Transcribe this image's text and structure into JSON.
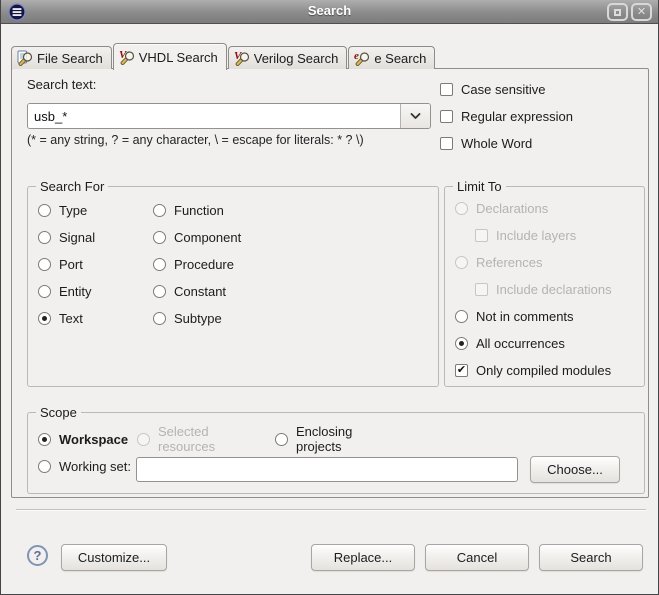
{
  "window": {
    "title": "Search"
  },
  "tabs": [
    {
      "label": "File Search"
    },
    {
      "label": "VHDL Search"
    },
    {
      "label": "Verilog Search"
    },
    {
      "label": "e Search"
    }
  ],
  "search": {
    "label": "Search text:",
    "value": "usb_*",
    "hint": "(* = any string, ? = any character, \\ = escape for literals: * ? \\)"
  },
  "options": [
    {
      "label": "Case sensitive",
      "on": false
    },
    {
      "label": "Regular expression",
      "on": false
    },
    {
      "label": "Whole Word",
      "on": false
    }
  ],
  "search_for": {
    "title": "Search For",
    "col1": [
      {
        "label": "Type",
        "on": false
      },
      {
        "label": "Signal",
        "on": false
      },
      {
        "label": "Port",
        "on": false
      },
      {
        "label": "Entity",
        "on": false
      },
      {
        "label": "Text",
        "on": true
      }
    ],
    "col2": [
      {
        "label": "Function",
        "on": false
      },
      {
        "label": "Component",
        "on": false
      },
      {
        "label": "Procedure",
        "on": false
      },
      {
        "label": "Constant",
        "on": false
      },
      {
        "label": "Subtype",
        "on": false
      }
    ]
  },
  "limit_to": {
    "title": "Limit To",
    "items": [
      {
        "label": "Declarations",
        "type": "radio",
        "on": false,
        "disabled": true,
        "indent": false
      },
      {
        "label": "Include layers",
        "type": "checkbox",
        "on": false,
        "disabled": true,
        "indent": true
      },
      {
        "label": "References",
        "type": "radio",
        "on": false,
        "disabled": true,
        "indent": false
      },
      {
        "label": "Include declarations",
        "type": "checkbox",
        "on": false,
        "disabled": true,
        "indent": true
      },
      {
        "label": "Not in comments",
        "type": "radio",
        "on": false,
        "disabled": false,
        "indent": false
      },
      {
        "label": "All occurrences",
        "type": "radio",
        "on": true,
        "disabled": false,
        "indent": false
      },
      {
        "label": "Only compiled modules",
        "type": "checkbox",
        "on": true,
        "disabled": false,
        "indent": false
      }
    ]
  },
  "scope": {
    "title": "Scope",
    "workspace": {
      "label": "Workspace",
      "on": true,
      "disabled": false
    },
    "selected_resources": {
      "label": "Selected resources",
      "on": false,
      "disabled": true
    },
    "enclosing_projects": {
      "label": "Enclosing projects",
      "on": false,
      "disabled": false
    },
    "working_set": {
      "label": "Working set:",
      "on": false,
      "value": "",
      "choose": "Choose..."
    }
  },
  "footer": {
    "help": "?",
    "customize": "Customize...",
    "replace": "Replace...",
    "cancel": "Cancel",
    "search": "Search"
  },
  "colors": {
    "titlebar": "#8b8b8b",
    "panel_bg": "#f1f0ee",
    "tab_icon_red": "#8c0d0d",
    "magnifier_handle": "#d9b85c",
    "help_ring": "#8194b5"
  }
}
